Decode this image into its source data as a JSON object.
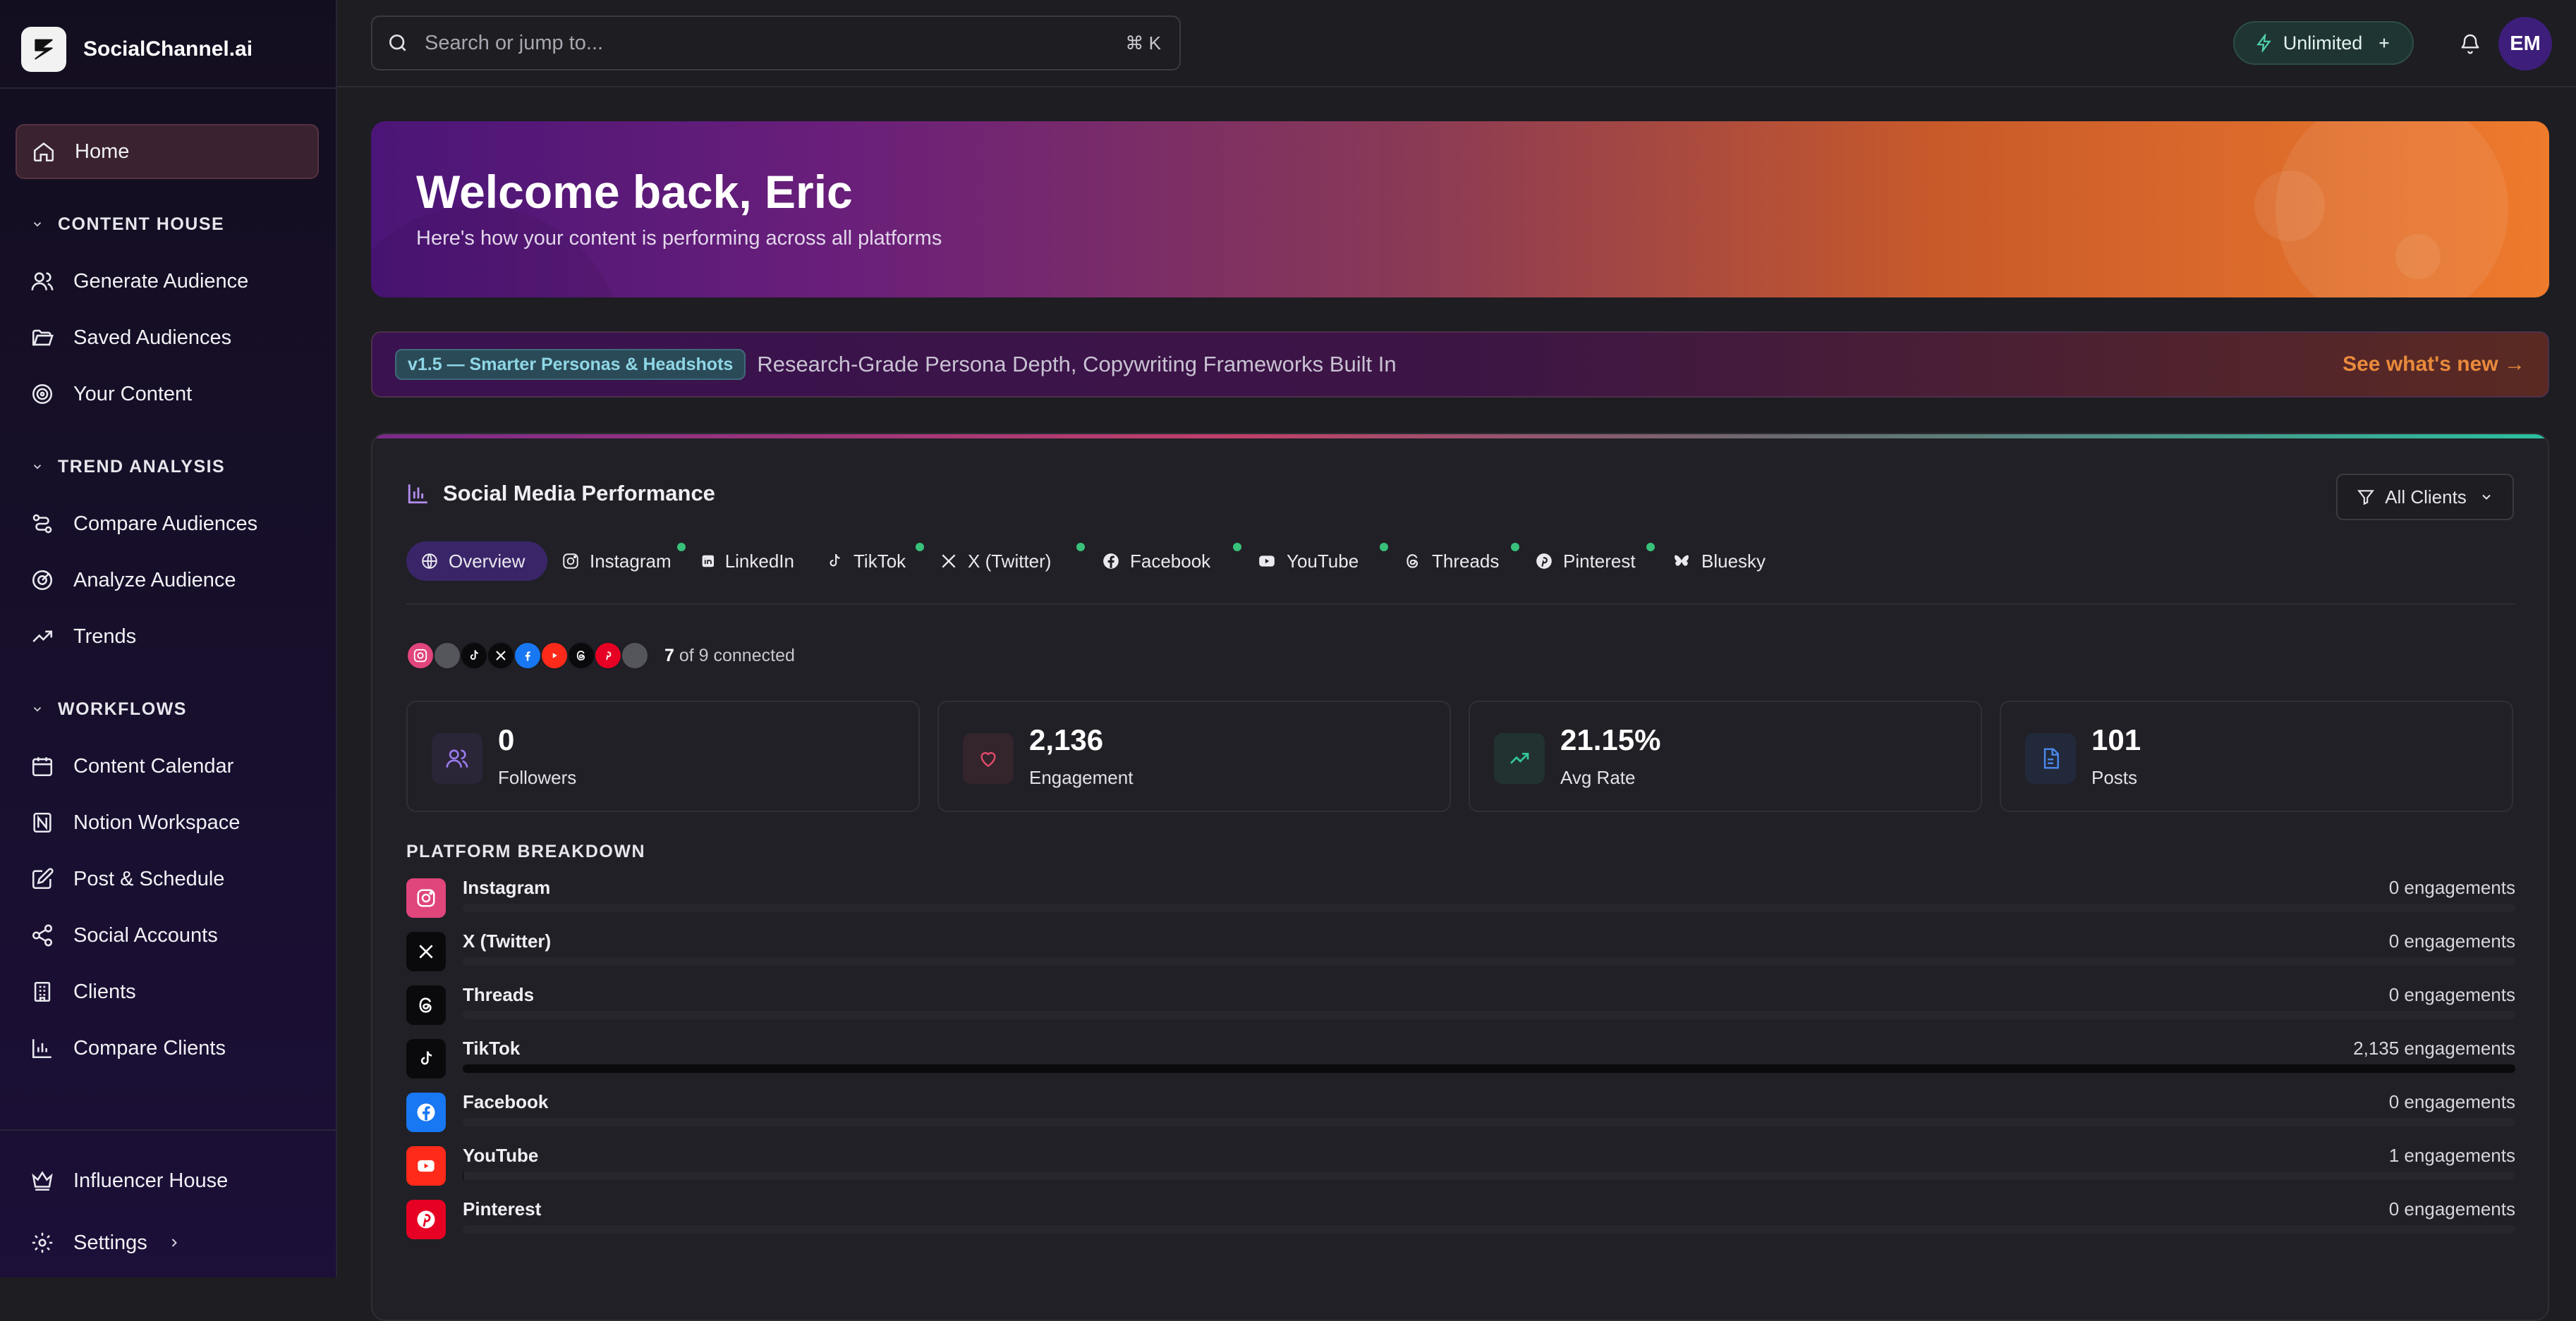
{
  "brand": {
    "name": "SocialChannel.ai"
  },
  "sidebar": {
    "home": "Home",
    "sections": [
      {
        "title": "CONTENT HOUSE",
        "items": [
          "Generate Audience",
          "Saved Audiences",
          "Your Content"
        ]
      },
      {
        "title": "TREND ANALYSIS",
        "items": [
          "Compare Audiences",
          "Analyze Audience",
          "Trends"
        ]
      },
      {
        "title": "WORKFLOWS",
        "items": [
          "Content Calendar",
          "Notion Workspace",
          "Post & Schedule",
          "Social Accounts",
          "Clients",
          "Compare Clients"
        ]
      }
    ],
    "bottom": {
      "influencer": "Influencer House",
      "settings": "Settings"
    }
  },
  "topbar": {
    "search_placeholder": "Search or jump to...",
    "search_shortcut": "⌘ K",
    "plan": "Unlimited",
    "avatar_initials": "EM"
  },
  "hero": {
    "title": "Welcome back, Eric",
    "subtitle": "Here's how your content is performing across all platforms"
  },
  "announcement": {
    "badge": "v1.5 — Smarter Personas & Headshots",
    "text": "Research-Grade Persona Depth, Copywriting Frameworks Built In",
    "link": "See what's new →"
  },
  "performance": {
    "title": "Social Media Performance",
    "filter": "All Clients",
    "tabs": [
      "Overview",
      "Instagram",
      "LinkedIn",
      "TikTok",
      "X (Twitter)",
      "Facebook",
      "YouTube",
      "Threads",
      "Pinterest",
      "Bluesky"
    ],
    "connected_count": "7",
    "connected_text": "of 9 connected",
    "stats": [
      {
        "value": "0",
        "label": "Followers"
      },
      {
        "value": "2,136",
        "label": "Engagement"
      },
      {
        "value": "21.15%",
        "label": "Avg Rate"
      },
      {
        "value": "101",
        "label": "Posts"
      }
    ],
    "breakdown_title": "PLATFORM BREAKDOWN",
    "platforms": [
      {
        "name": "Instagram",
        "value": "0 engagements",
        "share": 0
      },
      {
        "name": "X (Twitter)",
        "value": "0 engagements",
        "share": 0
      },
      {
        "name": "Threads",
        "value": "0 engagements",
        "share": 0
      },
      {
        "name": "TikTok",
        "value": "2,135 engagements",
        "share": 1
      },
      {
        "name": "Facebook",
        "value": "0 engagements",
        "share": 0
      },
      {
        "name": "YouTube",
        "value": "1 engagements",
        "share": 0.0005
      },
      {
        "name": "Pinterest",
        "value": "0 engagements",
        "share": 0
      }
    ]
  },
  "colors": {
    "accent_purple": "#3a2569",
    "instagram": "#e0457b",
    "facebook": "#1877f2",
    "youtube": "#ff2a1a",
    "pinterest": "#e60023",
    "connected_dot": "#39c07a",
    "see_whats_new": "#e98a3c"
  }
}
